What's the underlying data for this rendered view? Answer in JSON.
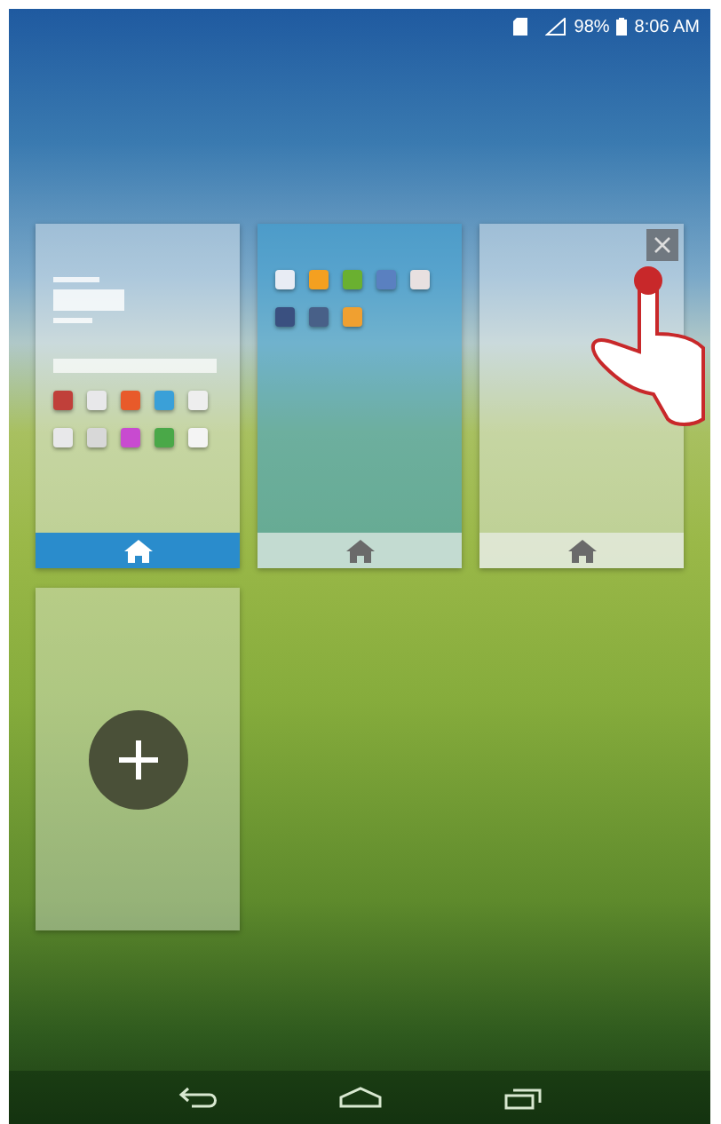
{
  "status_bar": {
    "battery": "98%",
    "time": "8:06 AM"
  },
  "home_screens": [
    {
      "kind": "widgets",
      "selected": true,
      "current": false,
      "close_visible": false
    },
    {
      "kind": "apps",
      "selected": false,
      "current": true,
      "close_visible": false
    },
    {
      "kind": "empty",
      "selected": false,
      "current": false,
      "close_visible": true
    }
  ],
  "add_screen_tile": true,
  "touch_hint": true
}
